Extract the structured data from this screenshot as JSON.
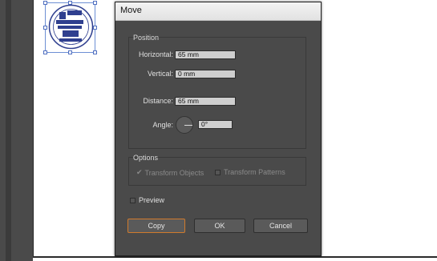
{
  "dialog": {
    "title": "Move",
    "position_group": "Position",
    "horizontal_label": "Horizontal:",
    "horizontal_value": "65 mm",
    "vertical_label": "Vertical:",
    "vertical_value": "0 mm",
    "distance_label": "Distance:",
    "distance_value": "65 mm",
    "angle_label": "Angle:",
    "angle_value": "0°",
    "options_group": "Options",
    "transform_objects_label": "Transform Objects",
    "transform_patterns_label": "Transform Patterns",
    "preview_label": "Preview",
    "copy_label": "Copy",
    "ok_label": "OK",
    "cancel_label": "Cancel"
  },
  "colors": {
    "dialog_bg": "#4a4a4a",
    "selection": "#6d8fd4",
    "focus": "#d07a2c"
  },
  "icons": [
    "angle-dial-icon",
    "checkmark-icon",
    "checkbox-icon",
    "logo-icon"
  ]
}
